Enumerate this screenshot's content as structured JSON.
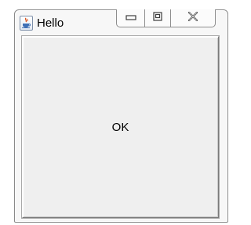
{
  "window": {
    "title": "Hello",
    "app_icon": "java-coffee-cup-icon",
    "caption_buttons": [
      {
        "name": "minimize",
        "icon": "minimize-icon"
      },
      {
        "name": "maximize",
        "icon": "maximize-icon"
      },
      {
        "name": "close",
        "icon": "close-icon"
      }
    ]
  },
  "content": {
    "button_label": "OK"
  },
  "colors": {
    "window_background": "#f7f7f7",
    "button_face": "#efefef",
    "border": "#8a8a8a"
  }
}
